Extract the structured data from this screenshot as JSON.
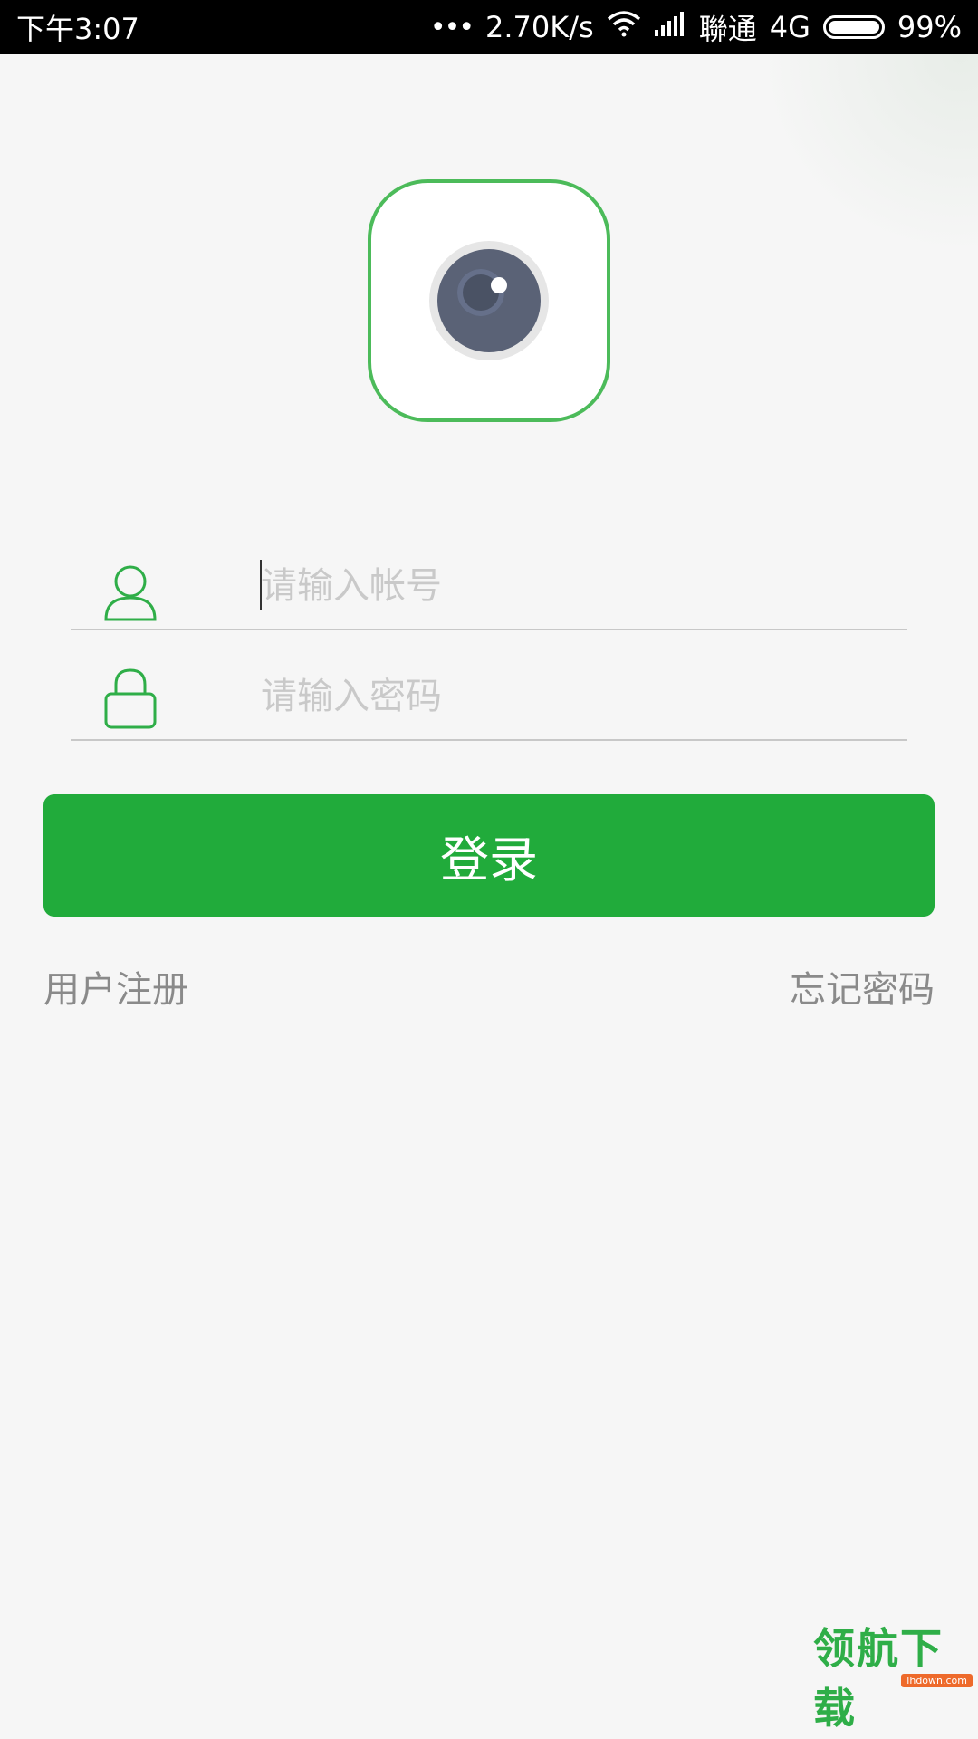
{
  "status_bar": {
    "time": "下午3:07",
    "network_speed": "2.70K/s",
    "carrier": "聯通",
    "network_type": "4G",
    "battery": "99%",
    "icons": [
      "more-dots-icon",
      "wifi-icon",
      "signal-icon",
      "battery-icon"
    ]
  },
  "logo": {
    "icon": "camera-lens-icon",
    "border_color": "#4cbb5a"
  },
  "form": {
    "account": {
      "icon": "user-icon",
      "placeholder": "请输入帐号",
      "value": ""
    },
    "password": {
      "icon": "lock-icon",
      "placeholder": "请输入密码",
      "value": ""
    }
  },
  "login_button": {
    "label": "登录",
    "color": "#21ab3b"
  },
  "links": {
    "register": "用户注册",
    "forgot_password": "忘记密码"
  },
  "watermark": {
    "text": "领航下载",
    "badge": "lhdown.com"
  }
}
